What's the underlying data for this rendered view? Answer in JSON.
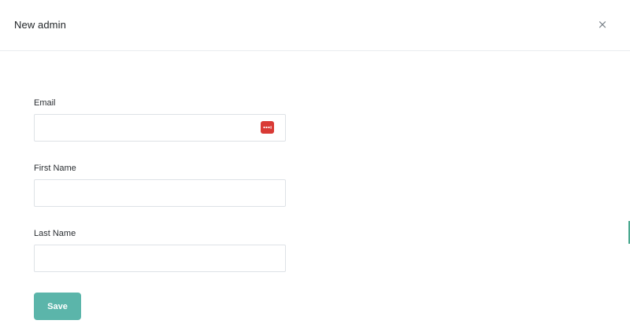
{
  "modal": {
    "title": "New admin",
    "close_icon": "close-icon",
    "close_glyph": "×"
  },
  "form": {
    "email": {
      "label": "Email",
      "value": "",
      "placeholder": ""
    },
    "first_name": {
      "label": "First Name",
      "value": "",
      "placeholder": ""
    },
    "last_name": {
      "label": "Last Name",
      "value": "",
      "placeholder": ""
    },
    "save_label": "Save"
  },
  "password_manager": {
    "icon": "password-manager-icon",
    "color": "#d93a35"
  },
  "colors": {
    "primary_button": "#5bb5aa",
    "border": "#dee2e6",
    "text": "#2b2f33"
  }
}
